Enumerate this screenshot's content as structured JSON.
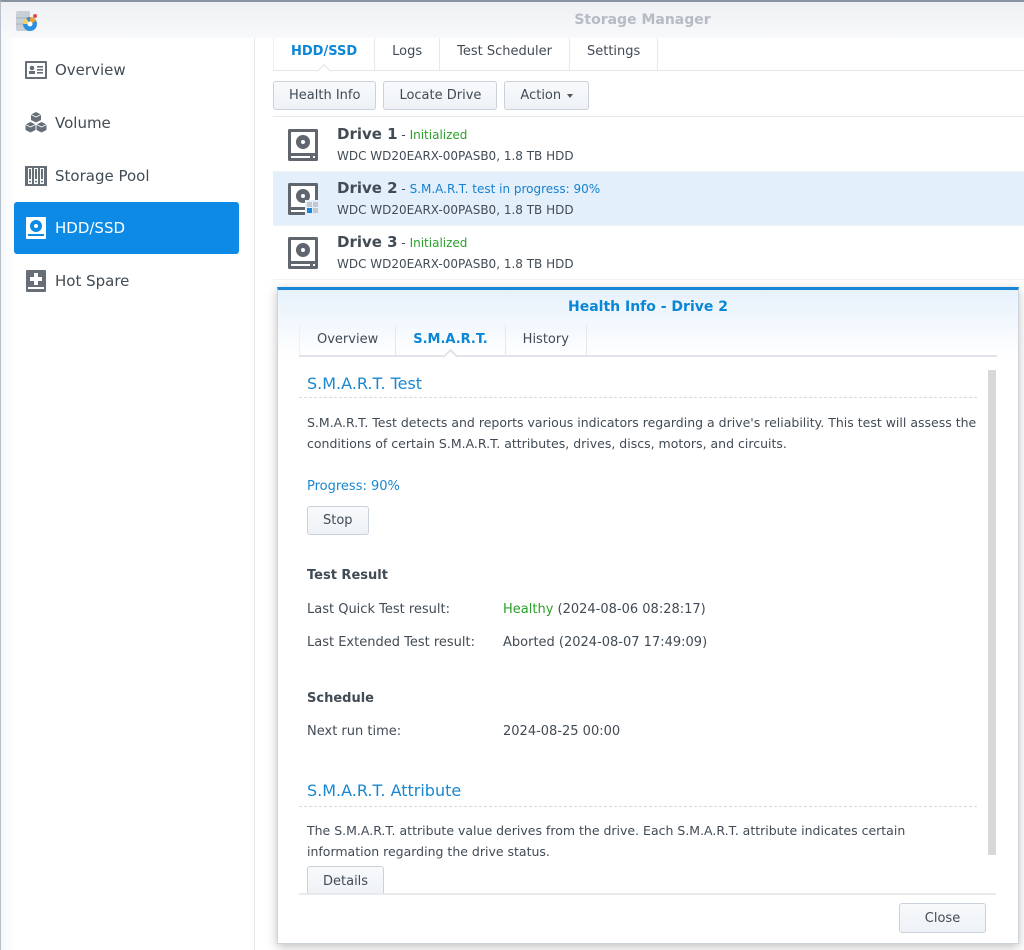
{
  "window": {
    "title": "Storage Manager"
  },
  "sidebar": {
    "items": [
      {
        "label": "Overview",
        "icon": "overview-icon",
        "active": false
      },
      {
        "label": "Volume",
        "icon": "volume-cubes-icon",
        "active": false
      },
      {
        "label": "Storage Pool",
        "icon": "storage-pool-icon",
        "active": false
      },
      {
        "label": "HDD/SSD",
        "icon": "hdd-icon",
        "active": true
      },
      {
        "label": "Hot Spare",
        "icon": "hot-spare-icon",
        "active": false
      }
    ]
  },
  "main": {
    "tabs": [
      {
        "label": "HDD/SSD",
        "active": true
      },
      {
        "label": "Logs",
        "active": false
      },
      {
        "label": "Test Scheduler",
        "active": false
      },
      {
        "label": "Settings",
        "active": false
      }
    ],
    "toolbar": {
      "health_info": "Health Info",
      "locate_drive": "Locate Drive",
      "action": "Action"
    },
    "drives": [
      {
        "name": "Drive 1",
        "separator": " - ",
        "status": "Initialized",
        "status_type": "ok",
        "model": "WDC WD20EARX-00PASB0, 1.8 TB HDD"
      },
      {
        "name": "Drive 2",
        "separator": " - ",
        "status": "S.M.A.R.T. test in progress: 90%",
        "status_type": "info",
        "model": "WDC WD20EARX-00PASB0, 1.8 TB HDD",
        "selected": true
      },
      {
        "name": "Drive 3",
        "separator": " - ",
        "status": "Initialized",
        "status_type": "ok",
        "model": "WDC WD20EARX-00PASB0, 1.8 TB HDD"
      }
    ]
  },
  "dialog": {
    "title": "Health Info - Drive 2",
    "tabs": [
      {
        "label": "Overview",
        "active": false
      },
      {
        "label": "S.M.A.R.T.",
        "active": true
      },
      {
        "label": "History",
        "active": false
      }
    ],
    "smart_test": {
      "title": "S.M.A.R.T. Test",
      "description": "S.M.A.R.T. Test detects and reports various indicators regarding a drive's reliability. This test will assess the conditions of certain S.M.A.R.T. attributes, drives, discs, motors, and circuits.",
      "progress_label": "Progress: 90%",
      "progress_percent": 90,
      "stop_button": "Stop"
    },
    "test_result": {
      "title": "Test Result",
      "quick_label": "Last Quick Test result:",
      "quick_status": "Healthy",
      "quick_time": " (2024-08-06 08:28:17)",
      "extended_label": "Last Extended Test result:",
      "extended_value": "Aborted (2024-08-07 17:49:09)"
    },
    "schedule": {
      "title": "Schedule",
      "next_run_label": "Next run time:",
      "next_run_value": "2024-08-25 00:00"
    },
    "smart_attribute": {
      "title": "S.M.A.R.T. Attribute",
      "description": "The S.M.A.R.T. attribute value derives from the drive. Each S.M.A.R.T. attribute indicates certain information regarding the drive status.",
      "details_button": "Details"
    },
    "close_button": "Close"
  },
  "colors": {
    "accent": "#0d8ae6",
    "title_blue": "#0a86d6",
    "ok_green": "#2aa02a",
    "selected_row": "#e3f0fb"
  }
}
